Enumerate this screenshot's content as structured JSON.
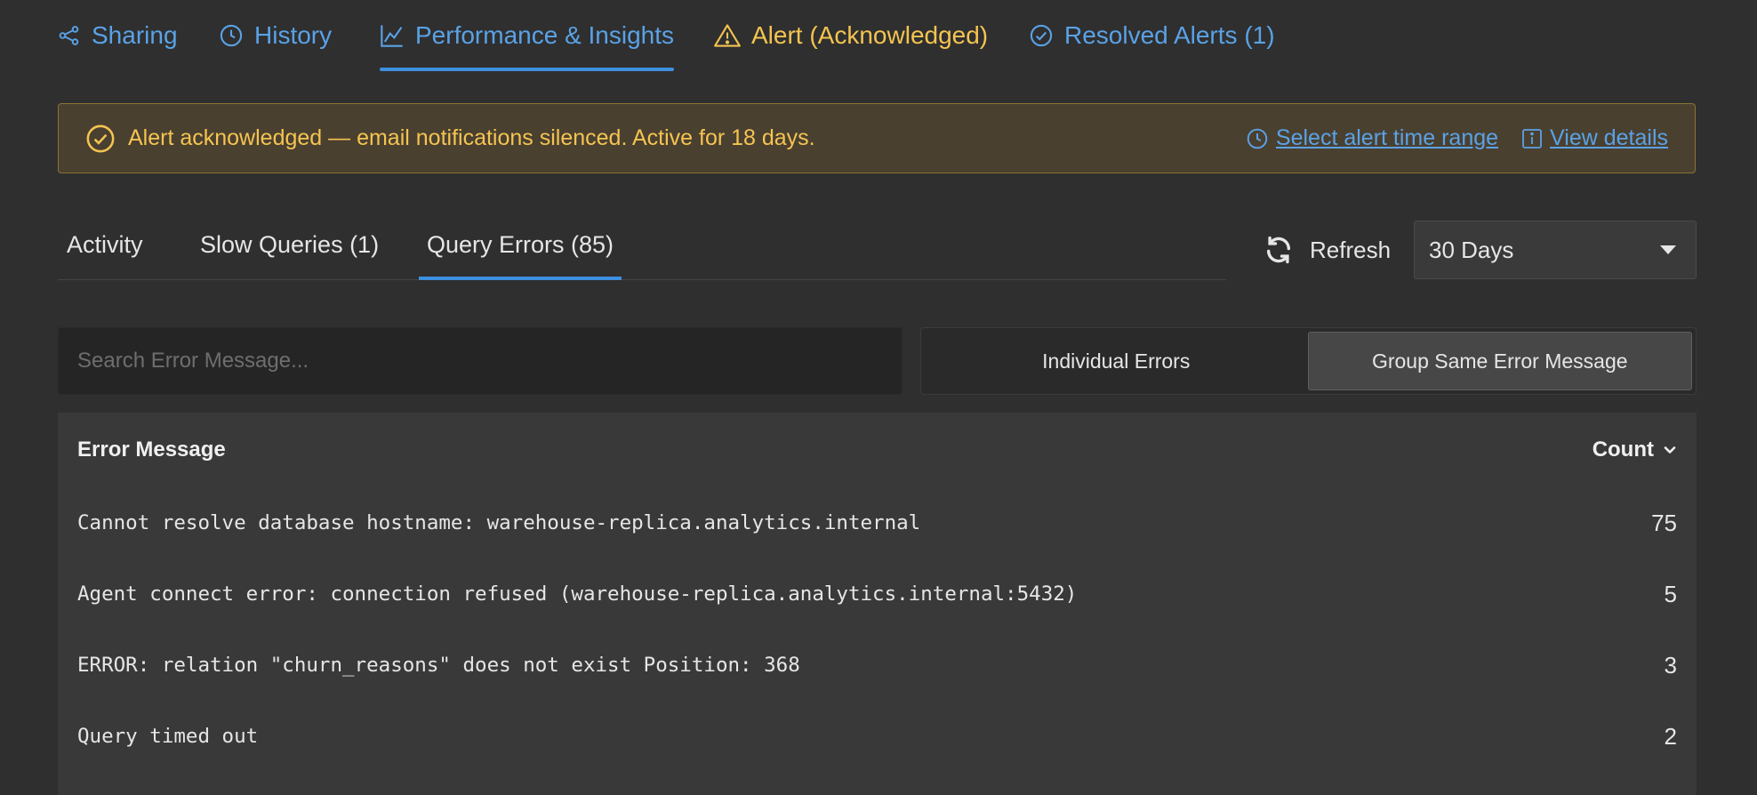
{
  "nav": {
    "tabs": [
      {
        "label": "Sharing",
        "icon": "share-icon"
      },
      {
        "label": "History",
        "icon": "clock-icon"
      },
      {
        "label": "Performance & Insights",
        "icon": "chart-icon",
        "active": true
      },
      {
        "label": "Alert (Acknowledged)",
        "icon": "warning-icon"
      },
      {
        "label": "Resolved Alerts (1)",
        "icon": "check-circle-icon"
      }
    ]
  },
  "banner": {
    "message": "Alert acknowledged — email notifications silenced. Active for 18 days.",
    "time_range_link": "Select alert time range",
    "details_link": "View details"
  },
  "subtabs": [
    {
      "label": "Activity"
    },
    {
      "label": "Slow Queries (1)"
    },
    {
      "label": "Query Errors (85)",
      "active": true
    }
  ],
  "controls": {
    "refresh_label": "Refresh",
    "range_value": "30 Days"
  },
  "search": {
    "placeholder": "Search Error Message..."
  },
  "toggle": {
    "individual": "Individual Errors",
    "grouped": "Group Same Error Message",
    "selected": "grouped"
  },
  "table": {
    "col_message": "Error Message",
    "col_count": "Count",
    "rows": [
      {
        "message": "Cannot resolve database hostname: warehouse-replica.analytics.internal",
        "count": "75"
      },
      {
        "message": "Agent connect error: connection refused (warehouse-replica.analytics.internal:5432)",
        "count": "5"
      },
      {
        "message": "ERROR: relation \"churn_reasons\" does not exist Position: 368",
        "count": "3"
      },
      {
        "message": "Query timed out",
        "count": "2"
      }
    ]
  },
  "colors": {
    "background": "#2f2f2f",
    "link": "#5aa2e6",
    "warning": "#f5c451",
    "accent": "#3d8fe0"
  }
}
